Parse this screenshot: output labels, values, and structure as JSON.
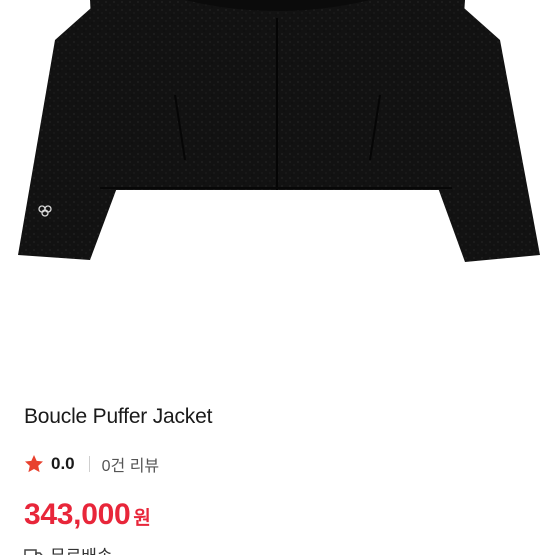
{
  "product": {
    "title": "Boucle Puffer Jacket",
    "image_icon": "jacket-photo",
    "rating": {
      "icon": "star-icon",
      "value": "0.0",
      "review_count": "0건 리뷰"
    },
    "price": {
      "amount": "343,000",
      "currency": "원"
    },
    "shipping": {
      "icon": "truck-icon",
      "label": "무료배송"
    }
  },
  "colors": {
    "accent_red": "#e8263a",
    "star_red": "#e8412e",
    "jacket_black": "#111111"
  }
}
